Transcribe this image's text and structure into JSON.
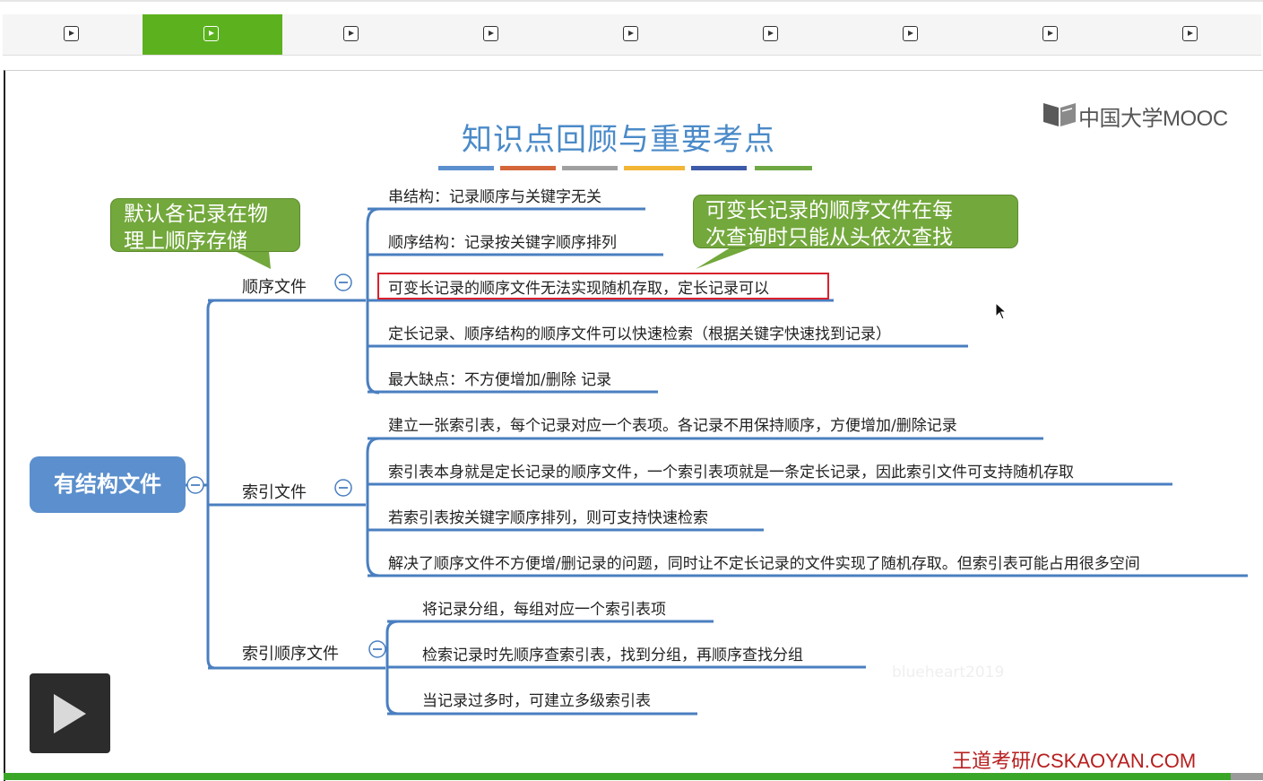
{
  "tabs": [
    {
      "id": 1,
      "active": false
    },
    {
      "id": 2,
      "active": true
    },
    {
      "id": 3,
      "active": false
    },
    {
      "id": 4,
      "active": false
    },
    {
      "id": 5,
      "active": false
    },
    {
      "id": 6,
      "active": false
    },
    {
      "id": 7,
      "active": false
    },
    {
      "id": 8,
      "active": false
    },
    {
      "id": 9,
      "active": false
    }
  ],
  "slide": {
    "title": "知识点回顾与重要考点",
    "logo": "中国大学MOOC",
    "watermark": "blueheart2019",
    "footer": "王道考研/CSKAOYAN.COM",
    "stripe_colors": [
      "#5b8fcd",
      "#d4663a",
      "#a0a0a0",
      "#f2b535",
      "#3d5aa8",
      "#6fa843"
    ]
  },
  "mindmap": {
    "root": "有结构文件",
    "branches": {
      "seq": {
        "label": "顺序文件",
        "items": [
          "串结构：记录顺序与关键字无关",
          "顺序结构：记录按关键字顺序排列",
          "可变长记录的顺序文件无法实现随机存取，定长记录可以",
          "定长记录、顺序结构的顺序文件可以快速检索（根据关键字快速找到记录）",
          "最大缺点：不方便增加/删除 记录"
        ]
      },
      "index": {
        "label": "索引文件",
        "items": [
          "建立一张索引表，每个记录对应一个表项。各记录不用保持顺序，方便增加/删除记录",
          "索引表本身就是定长记录的顺序文件，一个索引表项就是一条定长记录，因此索引文件可支持随机存取",
          "若索引表按关键字顺序排列，则可支持快速检索",
          "解决了顺序文件不方便增/删记录的问题，同时让不定长记录的文件实现了随机存取。但索引表可能占用很多空间"
        ]
      },
      "indexseq": {
        "label": "索引顺序文件",
        "items": [
          "将记录分组，每组对应一个索引表项",
          "检索记录时先顺序查索引表，找到分组，再顺序查找分组",
          "当记录过多时，可建立多级索引表"
        ]
      }
    }
  },
  "callouts": {
    "left": [
      "默认各记录在物",
      "理上顺序存储"
    ],
    "right": [
      "可变长记录的顺序文件在每",
      "次查询时只能从头依次查找"
    ]
  },
  "colors": {
    "accent_green": "#5cb21e",
    "node_blue": "#5b8fcd",
    "line_blue": "#4a7fc0",
    "callout_green": "#73a83c",
    "highlight_red": "#d8212e",
    "footer_red": "#b81e1e"
  }
}
